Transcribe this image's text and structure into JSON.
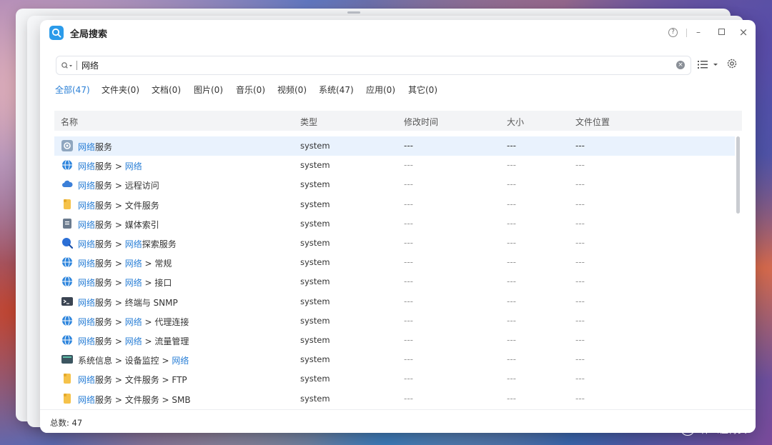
{
  "window": {
    "title": "全局搜索"
  },
  "search": {
    "query": "网络"
  },
  "tabs": [
    {
      "label": "全部(47)",
      "active": true
    },
    {
      "label": "文件夹(0)"
    },
    {
      "label": "文档(0)"
    },
    {
      "label": "图片(0)"
    },
    {
      "label": "音乐(0)"
    },
    {
      "label": "视频(0)"
    },
    {
      "label": "系统(47)"
    },
    {
      "label": "应用(0)"
    },
    {
      "label": "其它(0)"
    }
  ],
  "columns": {
    "name": "名称",
    "type": "类型",
    "modified": "修改时间",
    "size": "大小",
    "location": "文件位置"
  },
  "rows": [
    {
      "icon": "gear-icon",
      "name": [
        {
          "t": "网络",
          "h": true
        },
        {
          "t": "服务"
        }
      ],
      "type": "system",
      "modified": "---",
      "size": "---",
      "location": "---"
    },
    {
      "icon": "globe-icon",
      "name": [
        {
          "t": "网络",
          "h": true
        },
        {
          "t": "服务 > "
        },
        {
          "t": "网络",
          "h": true
        }
      ],
      "type": "system",
      "modified": "---",
      "size": "---",
      "location": "---"
    },
    {
      "icon": "cloud-icon",
      "name": [
        {
          "t": "网络",
          "h": true
        },
        {
          "t": "服务 > 远程访问"
        }
      ],
      "type": "system",
      "modified": "---",
      "size": "---",
      "location": "---"
    },
    {
      "icon": "folder-icon",
      "name": [
        {
          "t": "网络",
          "h": true
        },
        {
          "t": "服务 > 文件服务"
        }
      ],
      "type": "system",
      "modified": "---",
      "size": "---",
      "location": "---"
    },
    {
      "icon": "media-index-icon",
      "name": [
        {
          "t": "网络",
          "h": true
        },
        {
          "t": "服务 > 媒体索引"
        }
      ],
      "type": "system",
      "modified": "---",
      "size": "---",
      "location": "---"
    },
    {
      "icon": "search-icon",
      "name": [
        {
          "t": "网络",
          "h": true
        },
        {
          "t": "服务 > "
        },
        {
          "t": "网络",
          "h": true
        },
        {
          "t": "探索服务"
        }
      ],
      "type": "system",
      "modified": "---",
      "size": "---",
      "location": "---"
    },
    {
      "icon": "globe-icon",
      "name": [
        {
          "t": "网络",
          "h": true
        },
        {
          "t": "服务 > "
        },
        {
          "t": "网络",
          "h": true
        },
        {
          "t": " > 常规"
        }
      ],
      "type": "system",
      "modified": "---",
      "size": "---",
      "location": "---"
    },
    {
      "icon": "globe-icon",
      "name": [
        {
          "t": "网络",
          "h": true
        },
        {
          "t": "服务 > "
        },
        {
          "t": "网络",
          "h": true
        },
        {
          "t": " > 接口"
        }
      ],
      "type": "system",
      "modified": "---",
      "size": "---",
      "location": "---"
    },
    {
      "icon": "terminal-icon",
      "name": [
        {
          "t": "网络",
          "h": true
        },
        {
          "t": "服务 > 终端与 SNMP"
        }
      ],
      "type": "system",
      "modified": "---",
      "size": "---",
      "location": "---"
    },
    {
      "icon": "globe-icon",
      "name": [
        {
          "t": "网络",
          "h": true
        },
        {
          "t": "服务 > "
        },
        {
          "t": "网络",
          "h": true
        },
        {
          "t": " > 代理连接"
        }
      ],
      "type": "system",
      "modified": "---",
      "size": "---",
      "location": "---"
    },
    {
      "icon": "globe-icon",
      "name": [
        {
          "t": "网络",
          "h": true
        },
        {
          "t": "服务 > "
        },
        {
          "t": "网络",
          "h": true
        },
        {
          "t": " > 流量管理"
        }
      ],
      "type": "system",
      "modified": "---",
      "size": "---",
      "location": "---"
    },
    {
      "icon": "monitor-icon",
      "name": [
        {
          "t": "系统信息 > 设备监控 > "
        },
        {
          "t": "网络",
          "h": true
        }
      ],
      "type": "system",
      "modified": "---",
      "size": "---",
      "location": "---"
    },
    {
      "icon": "folder-icon",
      "name": [
        {
          "t": "网络",
          "h": true
        },
        {
          "t": "服务 > 文件服务 > FTP"
        }
      ],
      "type": "system",
      "modified": "---",
      "size": "---",
      "location": "---"
    },
    {
      "icon": "folder-icon",
      "name": [
        {
          "t": "网络",
          "h": true
        },
        {
          "t": "服务 > 文件服务 > SMB"
        }
      ],
      "type": "system",
      "modified": "---",
      "size": "---",
      "location": "---"
    }
  ],
  "footer": {
    "total": "总数: 47"
  },
  "watermark": {
    "icon_text": "值",
    "text": "什么值得买"
  },
  "colors": {
    "accent": "#2a7fd6",
    "selected_row": "#e9f2fd",
    "header_bg": "#f3f4f6"
  }
}
